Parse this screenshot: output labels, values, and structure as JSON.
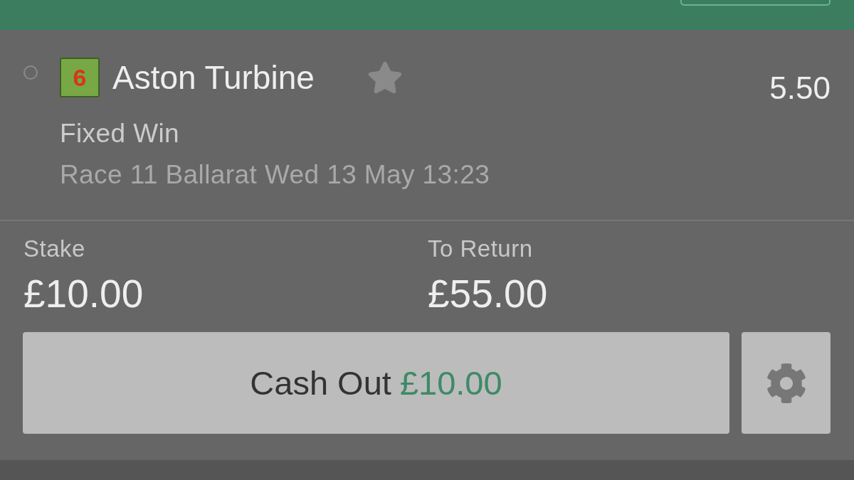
{
  "bet": {
    "selected": false,
    "runner": {
      "number": "6",
      "name": "Aston Turbine",
      "starred": false
    },
    "odds": "5.50",
    "bet_type": "Fixed Win",
    "event": "Race 11 Ballarat Wed 13 May 13:23"
  },
  "stake": {
    "label": "Stake",
    "value": "£10.00"
  },
  "to_return": {
    "label": "To Return",
    "value": "£55.00"
  },
  "cash_out": {
    "label": "Cash Out",
    "amount": "£10.00"
  }
}
